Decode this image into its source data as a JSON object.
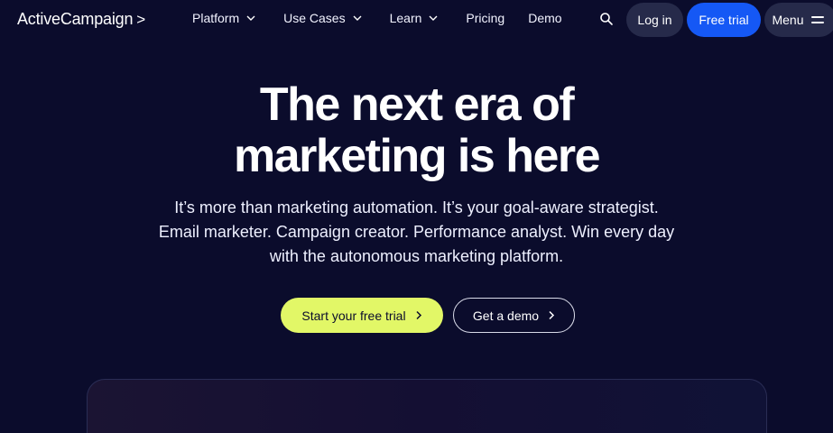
{
  "header": {
    "logo_text": "ActiveCampaign",
    "logo_mark": ">",
    "nav": [
      {
        "label": "Platform",
        "has_dropdown": true
      },
      {
        "label": "Use Cases",
        "has_dropdown": true
      },
      {
        "label": "Learn",
        "has_dropdown": true
      },
      {
        "label": "Pricing",
        "has_dropdown": false
      },
      {
        "label": "Demo",
        "has_dropdown": false
      }
    ],
    "search_icon": "search-icon",
    "login_label": "Log in",
    "free_trial_label": "Free trial",
    "menu_label": "Menu"
  },
  "hero": {
    "title_line1": "The next era of",
    "title_line2": "marketing is here",
    "subtitle_line1": "It’s more than marketing automation. It’s your goal-aware strategist.",
    "subtitle_line2": "Email marketer. Campaign creator. Performance analyst. Win every day",
    "subtitle_line3": "with the autonomous marketing platform.",
    "primary_cta": "Start your free trial",
    "secondary_cta": "Get a demo"
  },
  "colors": {
    "background": "#0b0c2c",
    "primary_blue": "#1558f5",
    "accent_lime": "#e2f767",
    "pill_dark": "#262a4a"
  }
}
